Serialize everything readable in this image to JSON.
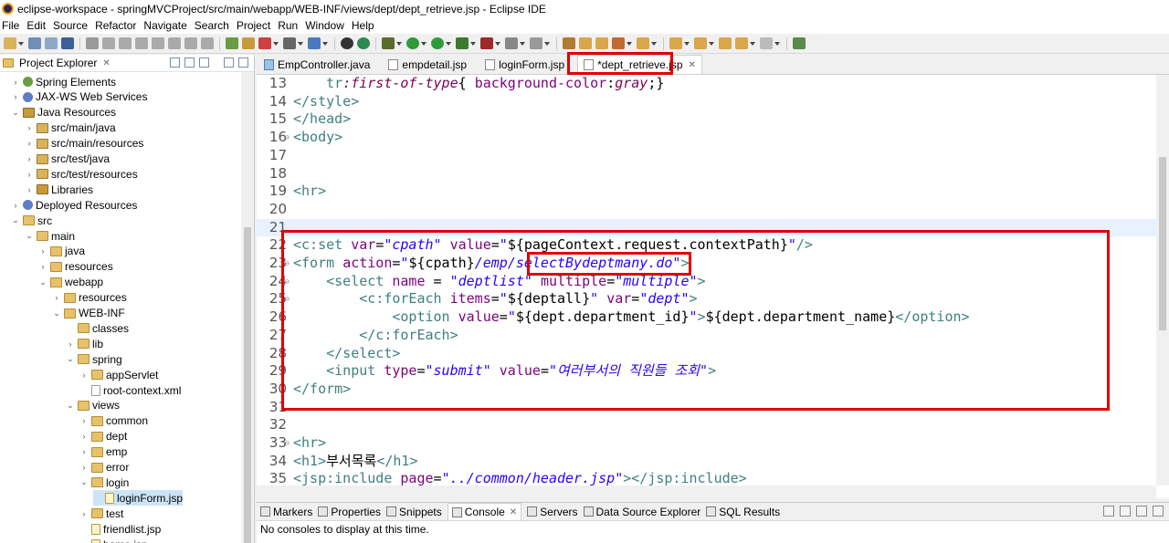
{
  "window": {
    "title": "eclipse-workspace - springMVCProject/src/main/webapp/WEB-INF/views/dept/dept_retrieve.jsp - Eclipse IDE"
  },
  "menu": [
    "File",
    "Edit",
    "Source",
    "Refactor",
    "Navigate",
    "Search",
    "Project",
    "Run",
    "Window",
    "Help"
  ],
  "explorer": {
    "title": "Project Explorer",
    "items": [
      {
        "label": "Spring Elements",
        "depth": 1,
        "chev": "›",
        "icon": "spring-elements-icon"
      },
      {
        "label": "JAX-WS Web Services",
        "depth": 1,
        "chev": "›",
        "icon": "web-services-icon"
      },
      {
        "label": "Java Resources",
        "depth": 1,
        "chev": "⌄",
        "icon": "java-resources-icon"
      },
      {
        "label": "src/main/java",
        "depth": 2,
        "chev": "›",
        "icon": "source-folder-icon"
      },
      {
        "label": "src/main/resources",
        "depth": 2,
        "chev": "›",
        "icon": "source-folder-icon"
      },
      {
        "label": "src/test/java",
        "depth": 2,
        "chev": "›",
        "icon": "source-folder-icon"
      },
      {
        "label": "src/test/resources",
        "depth": 2,
        "chev": "›",
        "icon": "source-folder-icon"
      },
      {
        "label": "Libraries",
        "depth": 2,
        "chev": "›",
        "icon": "libraries-icon"
      },
      {
        "label": "Deployed Resources",
        "depth": 1,
        "chev": "›",
        "icon": "deployed-resources-icon"
      },
      {
        "label": "src",
        "depth": 1,
        "chev": "⌄",
        "icon": "folder-icon"
      },
      {
        "label": "main",
        "depth": 2,
        "chev": "⌄",
        "icon": "folder-icon"
      },
      {
        "label": "java",
        "depth": 3,
        "chev": "›",
        "icon": "folder-icon"
      },
      {
        "label": "resources",
        "depth": 3,
        "chev": "›",
        "icon": "folder-icon"
      },
      {
        "label": "webapp",
        "depth": 3,
        "chev": "⌄",
        "icon": "folder-icon"
      },
      {
        "label": "resources",
        "depth": 4,
        "chev": "›",
        "icon": "folder-icon"
      },
      {
        "label": "WEB-INF",
        "depth": 4,
        "chev": "⌄",
        "icon": "folder-icon"
      },
      {
        "label": "classes",
        "depth": 5,
        "chev": "",
        "icon": "folder-icon"
      },
      {
        "label": "lib",
        "depth": 5,
        "chev": "›",
        "icon": "folder-icon"
      },
      {
        "label": "spring",
        "depth": 5,
        "chev": "⌄",
        "icon": "folder-icon"
      },
      {
        "label": "appServlet",
        "depth": 6,
        "chev": "›",
        "icon": "folder-icon"
      },
      {
        "label": "root-context.xml",
        "depth": 6,
        "chev": "",
        "icon": "xml-file-icon"
      },
      {
        "label": "views",
        "depth": 5,
        "chev": "⌄",
        "icon": "folder-icon"
      },
      {
        "label": "common",
        "depth": 6,
        "chev": "›",
        "icon": "folder-icon"
      },
      {
        "label": "dept",
        "depth": 6,
        "chev": "›",
        "icon": "folder-icon"
      },
      {
        "label": "emp",
        "depth": 6,
        "chev": "›",
        "icon": "folder-icon"
      },
      {
        "label": "error",
        "depth": 6,
        "chev": "›",
        "icon": "folder-icon"
      },
      {
        "label": "login",
        "depth": 6,
        "chev": "⌄",
        "icon": "folder-icon"
      },
      {
        "label": "loginForm.jsp",
        "depth": 7,
        "chev": "",
        "icon": "jsp-file-icon",
        "selected": true
      },
      {
        "label": "test",
        "depth": 6,
        "chev": "›",
        "icon": "folder-icon"
      },
      {
        "label": "friendlist.jsp",
        "depth": 6,
        "chev": "",
        "icon": "jsp-file-icon"
      },
      {
        "label": "home.jsp",
        "depth": 6,
        "chev": "",
        "icon": "jsp-file-icon"
      }
    ]
  },
  "editor": {
    "tabs": [
      {
        "label": "EmpController.java",
        "active": false,
        "icon": "java-file-icon"
      },
      {
        "label": "empdetail.jsp",
        "active": false,
        "icon": "jsp-file-icon"
      },
      {
        "label": "loginForm.jsp",
        "active": false,
        "icon": "jsp-file-icon"
      },
      {
        "label": "*dept_retrieve.jsp",
        "active": true,
        "icon": "jsp-file-icon"
      }
    ],
    "lines": [
      {
        "n": "13",
        "fold": false,
        "segs": [
          [
            "",
            "    "
          ],
          [
            "kw",
            "tr"
          ],
          [
            "css",
            ":first-of-type"
          ],
          [
            "",
            "{ "
          ],
          [
            "at",
            "background-color"
          ],
          [
            "",
            ":"
          ],
          [
            "css",
            "gray"
          ],
          [
            "",
            ";}"
          ]
        ]
      },
      {
        "n": "14",
        "fold": false,
        "segs": [
          [
            "kw",
            "</style>"
          ]
        ]
      },
      {
        "n": "15",
        "fold": false,
        "segs": [
          [
            "kw",
            "</head>"
          ]
        ]
      },
      {
        "n": "16",
        "fold": true,
        "segs": [
          [
            "kw",
            "<body>"
          ]
        ]
      },
      {
        "n": "17",
        "fold": false,
        "segs": []
      },
      {
        "n": "18",
        "fold": false,
        "segs": []
      },
      {
        "n": "19",
        "fold": false,
        "segs": [
          [
            "kw",
            "<hr>"
          ]
        ]
      },
      {
        "n": "20",
        "fold": false,
        "segs": []
      },
      {
        "n": "21",
        "fold": false,
        "current": true,
        "segs": []
      },
      {
        "n": "22",
        "fold": false,
        "segs": [
          [
            "kw",
            "<c:set "
          ],
          [
            "at",
            "var"
          ],
          [
            "",
            "="
          ],
          [
            "str",
            "\"cpath\""
          ],
          [
            "",
            " "
          ],
          [
            "at",
            "value"
          ],
          [
            "",
            "="
          ],
          [
            "str",
            "\""
          ],
          [
            "",
            "${pageContext.request.contextPath}"
          ],
          [
            "str",
            "\""
          ],
          [
            "kw",
            "/>"
          ]
        ]
      },
      {
        "n": "23",
        "fold": true,
        "segs": [
          [
            "kw",
            "<form "
          ],
          [
            "at",
            "action"
          ],
          [
            "",
            "="
          ],
          [
            "str",
            "\""
          ],
          [
            "",
            "${cpath}"
          ],
          [
            "str",
            "/emp/selectBydeptmany.do\""
          ],
          [
            "kw",
            ">"
          ]
        ]
      },
      {
        "n": "24",
        "fold": true,
        "segs": [
          [
            "",
            "    "
          ],
          [
            "kw",
            "<select "
          ],
          [
            "at",
            "name"
          ],
          [
            "",
            " = "
          ],
          [
            "str",
            "\"deptlist\""
          ],
          [
            "",
            " "
          ],
          [
            "at",
            "multiple"
          ],
          [
            "",
            "="
          ],
          [
            "str",
            "\"multiple\""
          ],
          [
            "kw",
            ">"
          ]
        ]
      },
      {
        "n": "25",
        "fold": true,
        "segs": [
          [
            "",
            "        "
          ],
          [
            "kw",
            "<c:forEach "
          ],
          [
            "at",
            "items"
          ],
          [
            "",
            "="
          ],
          [
            "str",
            "\""
          ],
          [
            "",
            "${deptall}"
          ],
          [
            "str",
            "\""
          ],
          [
            "",
            " "
          ],
          [
            "at",
            "var"
          ],
          [
            "",
            "="
          ],
          [
            "str",
            "\"dept\""
          ],
          [
            "kw",
            ">"
          ]
        ]
      },
      {
        "n": "26",
        "fold": false,
        "segs": [
          [
            "",
            "            "
          ],
          [
            "kw",
            "<option "
          ],
          [
            "at",
            "value"
          ],
          [
            "",
            "="
          ],
          [
            "str",
            "\""
          ],
          [
            "",
            "${dept.department_id}"
          ],
          [
            "str",
            "\""
          ],
          [
            "kw",
            ">"
          ],
          [
            "",
            "${dept.department_name}"
          ],
          [
            "kw",
            "</option>"
          ]
        ]
      },
      {
        "n": "27",
        "fold": false,
        "segs": [
          [
            "",
            "        "
          ],
          [
            "kw",
            "</c:forEach>"
          ]
        ]
      },
      {
        "n": "28",
        "fold": false,
        "segs": [
          [
            "",
            "    "
          ],
          [
            "kw",
            "</select>"
          ]
        ]
      },
      {
        "n": "29",
        "fold": false,
        "segs": [
          [
            "",
            "    "
          ],
          [
            "kw",
            "<input "
          ],
          [
            "at",
            "type"
          ],
          [
            "",
            "="
          ],
          [
            "str",
            "\"submit\""
          ],
          [
            "",
            " "
          ],
          [
            "at",
            "value"
          ],
          [
            "",
            "="
          ],
          [
            "str",
            "\"여러부서의 직원들 조회\""
          ],
          [
            "kw",
            ">"
          ]
        ]
      },
      {
        "n": "30",
        "fold": false,
        "segs": [
          [
            "kw",
            "</form>"
          ]
        ]
      },
      {
        "n": "31",
        "fold": false,
        "segs": []
      },
      {
        "n": "32",
        "fold": false,
        "segs": []
      },
      {
        "n": "33",
        "fold": true,
        "segs": [
          [
            "kw",
            "<hr>"
          ]
        ]
      },
      {
        "n": "34",
        "fold": false,
        "segs": [
          [
            "kw",
            "<h1>"
          ],
          [
            "",
            "부서목록"
          ],
          [
            "kw",
            "</h1>"
          ]
        ]
      },
      {
        "n": "35",
        "fold": false,
        "segs": [
          [
            "kw",
            "<jsp:include "
          ],
          [
            "at",
            "page"
          ],
          [
            "",
            "="
          ],
          [
            "str",
            "\"../common/header.jsp\""
          ],
          [
            "kw",
            "></jsp:include>"
          ]
        ]
      }
    ]
  },
  "console": {
    "tabs": [
      {
        "label": "Markers",
        "active": false
      },
      {
        "label": "Properties",
        "active": false
      },
      {
        "label": "Snippets",
        "active": false
      },
      {
        "label": "Console",
        "active": true
      },
      {
        "label": "Servers",
        "active": false
      },
      {
        "label": "Data Source Explorer",
        "active": false
      },
      {
        "label": "SQL Results",
        "active": false
      }
    ],
    "message": "No consoles to display at this time."
  },
  "colors": {
    "highlight": "#e00000",
    "tag": "#3f7f7f",
    "attr": "#7f007f",
    "string": "#2a00ff",
    "selection": "#cde3f7"
  }
}
